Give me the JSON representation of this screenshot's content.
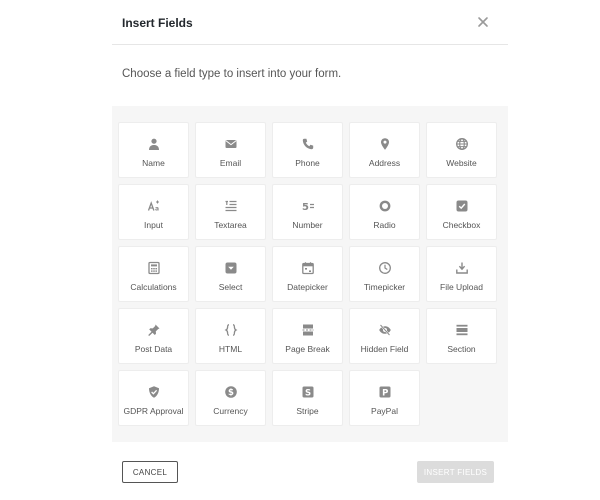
{
  "dialog": {
    "title": "Insert Fields",
    "intro": "Choose a field type to insert into your form."
  },
  "fields": [
    {
      "label": "Name",
      "icon": "user-icon"
    },
    {
      "label": "Email",
      "icon": "envelope-icon"
    },
    {
      "label": "Phone",
      "icon": "phone-icon"
    },
    {
      "label": "Address",
      "icon": "map-pin-icon"
    },
    {
      "label": "Website",
      "icon": "globe-icon"
    },
    {
      "label": "Input",
      "icon": "text-size-icon"
    },
    {
      "label": "Textarea",
      "icon": "text-lines-icon"
    },
    {
      "label": "Number",
      "icon": "number-icon"
    },
    {
      "label": "Radio",
      "icon": "radio-icon"
    },
    {
      "label": "Checkbox",
      "icon": "checkbox-icon"
    },
    {
      "label": "Calculations",
      "icon": "calculator-icon"
    },
    {
      "label": "Select",
      "icon": "select-icon"
    },
    {
      "label": "Datepicker",
      "icon": "calendar-icon"
    },
    {
      "label": "Timepicker",
      "icon": "clock-icon"
    },
    {
      "label": "File Upload",
      "icon": "upload-icon"
    },
    {
      "label": "Post Data",
      "icon": "pin-icon"
    },
    {
      "label": "HTML",
      "icon": "braces-icon"
    },
    {
      "label": "Page Break",
      "icon": "page-break-icon"
    },
    {
      "label": "Hidden Field",
      "icon": "eye-slash-icon"
    },
    {
      "label": "Section",
      "icon": "section-icon"
    },
    {
      "label": "GDPR Approval",
      "icon": "shield-check-icon"
    },
    {
      "label": "Currency",
      "icon": "dollar-icon"
    },
    {
      "label": "Stripe",
      "icon": "stripe-icon"
    },
    {
      "label": "PayPal",
      "icon": "paypal-icon"
    }
  ],
  "footer": {
    "cancel_label": "CANCEL",
    "insert_label": "INSERT FIELDS"
  },
  "colors": {
    "icon": "#8a8a8a",
    "panel_bg": "#f6f6f6",
    "insert_disabled_bg": "#dcdcdc"
  }
}
